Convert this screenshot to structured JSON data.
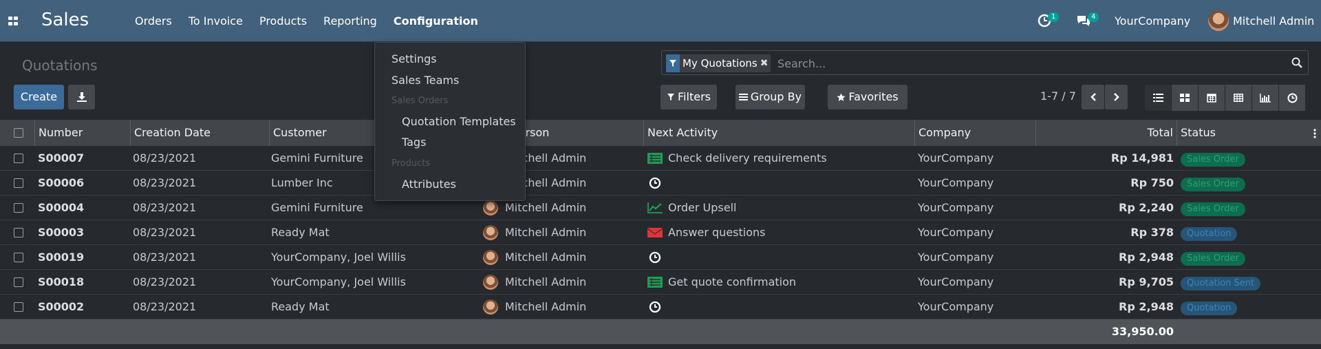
{
  "navbar": {
    "app_name": "Sales",
    "menu": [
      "Orders",
      "To Invoice",
      "Products",
      "Reporting",
      "Configuration"
    ],
    "activity_count": "1",
    "message_count": "4",
    "company": "YourCompany",
    "user": "Mitchell Admin"
  },
  "config_menu": {
    "settings": "Settings",
    "sales_teams": "Sales Teams",
    "sales_orders_header": "Sales Orders",
    "quotation_templates": "Quotation Templates",
    "tags": "Tags",
    "products_header": "Products",
    "attributes": "Attributes"
  },
  "control_panel": {
    "breadcrumb": "Quotations",
    "create_label": "Create",
    "facet_label": "My Quotations",
    "search_placeholder": "Search...",
    "filters_label": "Filters",
    "group_by_label": "Group By",
    "favorites_label": "Favorites",
    "pager": "1-7 / 7"
  },
  "table": {
    "columns": [
      "Number",
      "Creation Date",
      "Customer",
      "Salesperson",
      "Next Activity",
      "Company",
      "Total",
      "Status"
    ],
    "rows": [
      {
        "number": "S00007",
        "date": "08/23/2021",
        "customer": "Gemini Furniture",
        "salesperson": "Mitchell Admin",
        "activity": "Check delivery requirements",
        "activity_icon": "todo-list-icon",
        "company": "YourCompany",
        "total": "Rp 14,981",
        "status": "Sales Order",
        "status_kind": "green"
      },
      {
        "number": "S00006",
        "date": "08/23/2021",
        "customer": "Lumber Inc",
        "salesperson": "Mitchell Admin",
        "activity": "",
        "activity_icon": "clock-icon",
        "company": "YourCompany",
        "total": "Rp 750",
        "status": "Sales Order",
        "status_kind": "green"
      },
      {
        "number": "S00004",
        "date": "08/23/2021",
        "customer": "Gemini Furniture",
        "salesperson": "Mitchell Admin",
        "activity": "Order Upsell",
        "activity_icon": "line-chart-icon",
        "company": "YourCompany",
        "total": "Rp 2,240",
        "status": "Sales Order",
        "status_kind": "green"
      },
      {
        "number": "S00003",
        "date": "08/23/2021",
        "customer": "Ready Mat",
        "salesperson": "Mitchell Admin",
        "activity": "Answer questions",
        "activity_icon": "envelope-icon",
        "company": "YourCompany",
        "total": "Rp 378",
        "status": "Quotation",
        "status_kind": "blue"
      },
      {
        "number": "S00019",
        "date": "08/23/2021",
        "customer": "YourCompany, Joel Willis",
        "salesperson": "Mitchell Admin",
        "activity": "",
        "activity_icon": "clock-icon",
        "company": "YourCompany",
        "total": "Rp 2,948",
        "status": "Sales Order",
        "status_kind": "green"
      },
      {
        "number": "S00018",
        "date": "08/23/2021",
        "customer": "YourCompany, Joel Willis",
        "salesperson": "Mitchell Admin",
        "activity": "Get quote confirmation",
        "activity_icon": "todo-list-icon",
        "company": "YourCompany",
        "total": "Rp 9,705",
        "status": "Quotation Sent",
        "status_kind": "blue"
      },
      {
        "number": "S00002",
        "date": "08/23/2021",
        "customer": "Ready Mat",
        "salesperson": "Mitchell Admin",
        "activity": "",
        "activity_icon": "clock-icon",
        "company": "YourCompany",
        "total": "Rp 2,948",
        "status": "Quotation",
        "status_kind": "blue"
      }
    ],
    "grand_total": "33,950.00"
  },
  "colors": {
    "navbar": "#41617d",
    "primary": "#3c6b99",
    "status_green": "#27a277",
    "status_blue": "#3e84b8",
    "activity_green": "#28a745",
    "activity_red": "#dc3545"
  }
}
